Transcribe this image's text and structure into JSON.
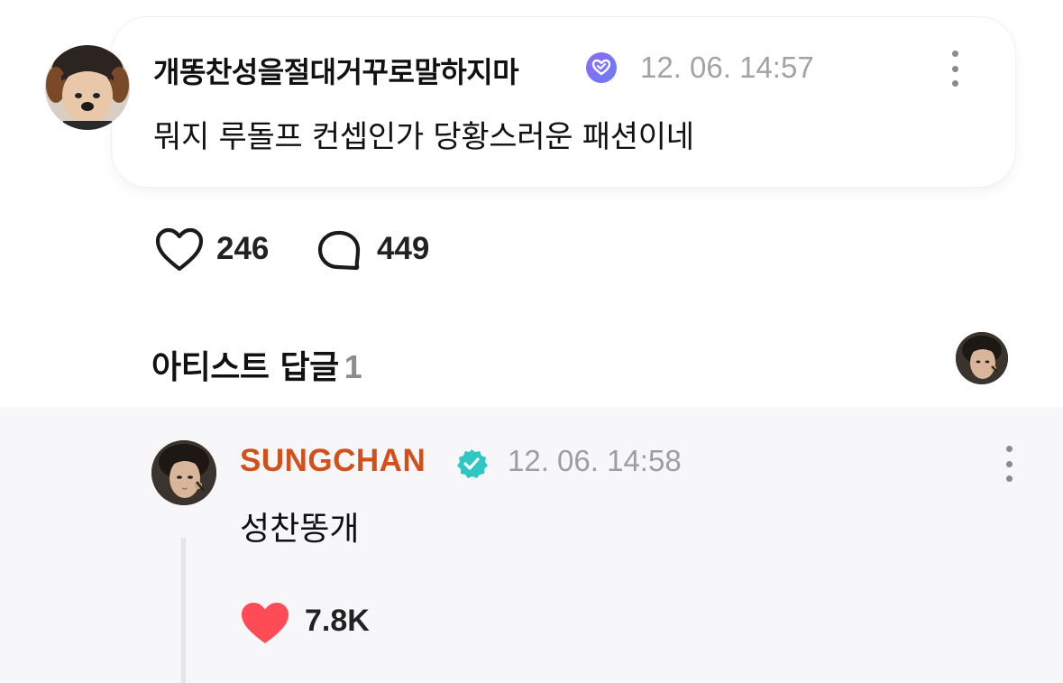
{
  "comment": {
    "author": "개똥찬성을절대거꾸로말하지마",
    "timestamp": "12. 06. 14:57",
    "body": "뭐지 루돌프 컨셉인가 당황스러운 패션이네",
    "badge_icon": "weverse-membership-icon",
    "likes": "246",
    "comments": "449"
  },
  "artist_replies": {
    "title": "아티스트 답글",
    "count": "1"
  },
  "artist_reply": {
    "author": "SUNGCHAN",
    "author_color": "#d4501b",
    "timestamp": "12. 06. 14:58",
    "body": "성찬똥개",
    "likes": "7.8K",
    "heart_color": "#ff4b55"
  }
}
